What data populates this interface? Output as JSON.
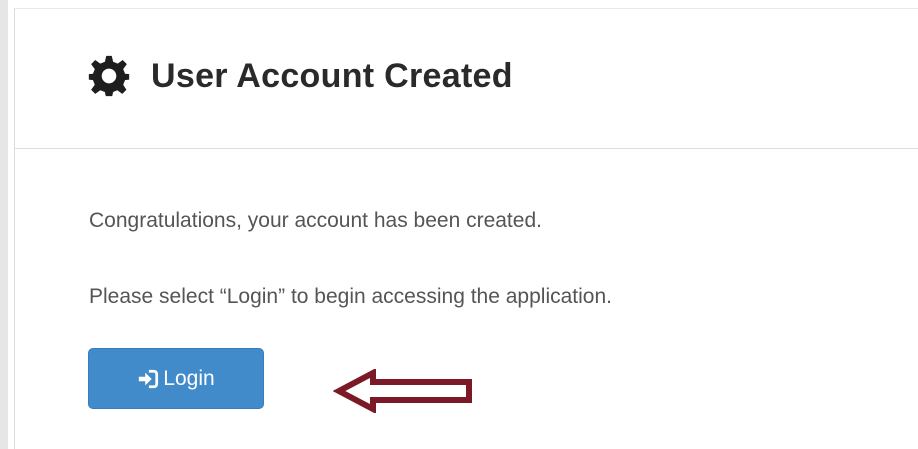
{
  "dialog": {
    "title": "User Account Created",
    "title_icon": "gear-icon"
  },
  "body": {
    "message_1": "Congratulations, your account has been created.",
    "message_2": "Please select “Login” to begin accessing the application."
  },
  "login_button": {
    "label": "Login",
    "icon": "sign-in-icon",
    "color": "#428bca"
  },
  "annotation": {
    "icon": "left-arrow-icon",
    "color": "#7b1a26"
  }
}
